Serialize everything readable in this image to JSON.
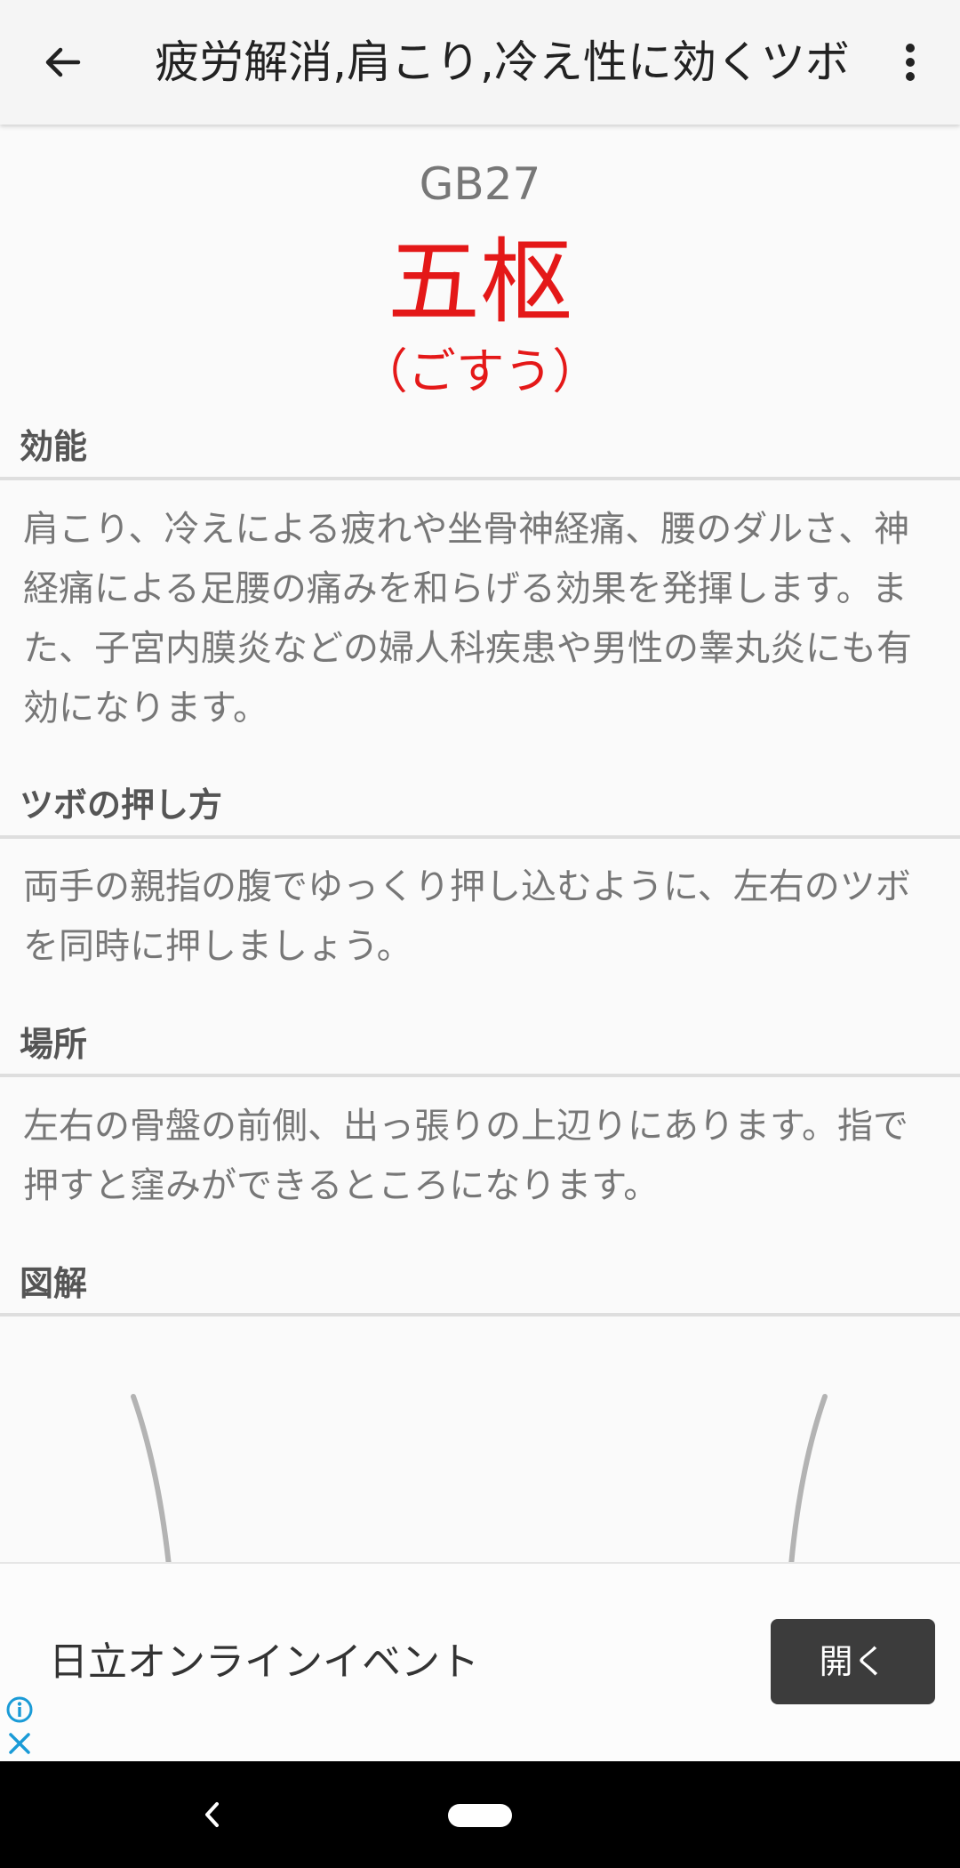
{
  "app_bar": {
    "title": "疲労解消,肩こり,冷え性に効くツボ",
    "back_icon": "arrow-left-icon",
    "more_icon": "more-vert-icon"
  },
  "point": {
    "code": "GB27",
    "name": "五枢",
    "reading": "（ごすう）"
  },
  "sections": {
    "effect": {
      "heading": "効能",
      "body": "肩こり、冷えによる疲れや坐骨神経痛、腰のダルさ、神経痛による足腰の痛みを和らげる効果を発揮します。また、子宮内膜炎などの婦人科疾患や男性の睾丸炎にも有効になります。"
    },
    "how_to_press": {
      "heading": "ツボの押し方",
      "body": "両手の親指の腹でゆっくり押し込むように、左右のツボを同時に押しましょう。"
    },
    "location": {
      "heading": "場所",
      "body": "左右の骨盤の前側、出っ張りの上辺りにあります。指で押すと窪みができるところになります。"
    },
    "illustration": {
      "heading": "図解"
    }
  },
  "ad": {
    "text": "日立オンラインイベント",
    "button_label": "開く",
    "info_icon": "info-icon",
    "close_icon": "close-icon"
  },
  "colors": {
    "accent_red": "#e41818",
    "app_bar_bg": "#f5f5f5",
    "ad_button_bg": "#3c3c3c"
  }
}
